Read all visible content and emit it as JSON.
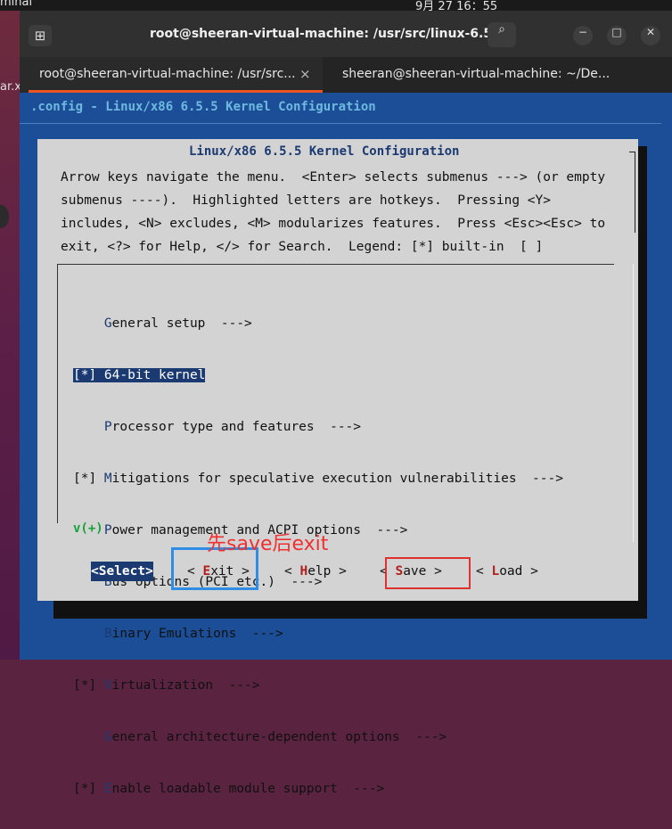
{
  "desktop": {
    "app_name": "minal",
    "clock": "9月 27  16：55",
    "side_label": "ar.x"
  },
  "window": {
    "title": "root@sheeran-virtual-machine: /usr/src/linux-6.5.5",
    "new_tab_icon": "plus-box-icon",
    "search_icon": "⌕",
    "menu_icon": "☰",
    "minimize_icon": "−",
    "maximize_icon": "□",
    "close_icon": "✕"
  },
  "tabs": [
    {
      "label": "root@sheeran-virtual-machine: /usr/src...",
      "close": "×",
      "active": true
    },
    {
      "label": "sheeran@sheeran-virtual-machine: ~/De...",
      "close": "×",
      "active": false
    }
  ],
  "menuconfig": {
    "config_title": ".config - Linux/x86 6.5.5 Kernel Configuration",
    "dialog_title": "Linux/x86 6.5.5 Kernel Configuration",
    "description": "Arrow keys navigate the menu.  <Enter> selects submenus ---> (or empty\nsubmenus ----).  Highlighted letters are hotkeys.  Pressing <Y>\nincludes, <N> excludes, <M> modularizes features.  Press <Esc><Esc> to\nexit, <?> for Help, </> for Search.  Legend: [*] built-in  [ ]",
    "items": [
      {
        "prefix": "    ",
        "hotkey": "G",
        "rest": "eneral setup  --->",
        "selected": false
      },
      {
        "prefix": "[*] ",
        "hotkey": "6",
        "rest": "4-bit kernel",
        "selected": true
      },
      {
        "prefix": "    ",
        "hotkey": "P",
        "rest": "rocessor type and features  --->",
        "selected": false
      },
      {
        "prefix": "[*] ",
        "hotkey": "M",
        "rest": "itigations for speculative execution vulnerabilities  --->",
        "selected": false
      },
      {
        "prefix": "    ",
        "hotkey": "P",
        "rest": "ower management and ACPI options  --->",
        "selected": false
      },
      {
        "prefix": "    ",
        "hotkey": "B",
        "rest": "us options (PCI etc.)  --->",
        "selected": false
      },
      {
        "prefix": "    ",
        "hotkey": "B",
        "rest": "inary Emulations  --->",
        "selected": false
      },
      {
        "prefix": "[*] ",
        "hotkey": "V",
        "rest": "irtualization  --->",
        "selected": false
      },
      {
        "prefix": "    ",
        "hotkey": "G",
        "rest": "eneral architecture-dependent options  --->",
        "selected": false
      },
      {
        "prefix": "[*] ",
        "hotkey": "E",
        "rest": "nable loadable module support  --->",
        "selected": false
      }
    ],
    "more_indicator": "v(+)",
    "buttons": {
      "select": {
        "pre": "<",
        "key": "S",
        "post": "elect>"
      },
      "exit": {
        "pre": "< ",
        "key": "E",
        "post": "xit >"
      },
      "help": {
        "pre": "< ",
        "key": "H",
        "post": "elp >"
      },
      "save": {
        "pre": "< ",
        "key": "S",
        "post": "ave >"
      },
      "load": {
        "pre": "< ",
        "key": "L",
        "post": "oad >"
      }
    }
  },
  "annotation": {
    "text": "先save后exit",
    "color": "#f03030",
    "exit_box_color": "#2f8de4",
    "save_box_color": "#e03131"
  }
}
